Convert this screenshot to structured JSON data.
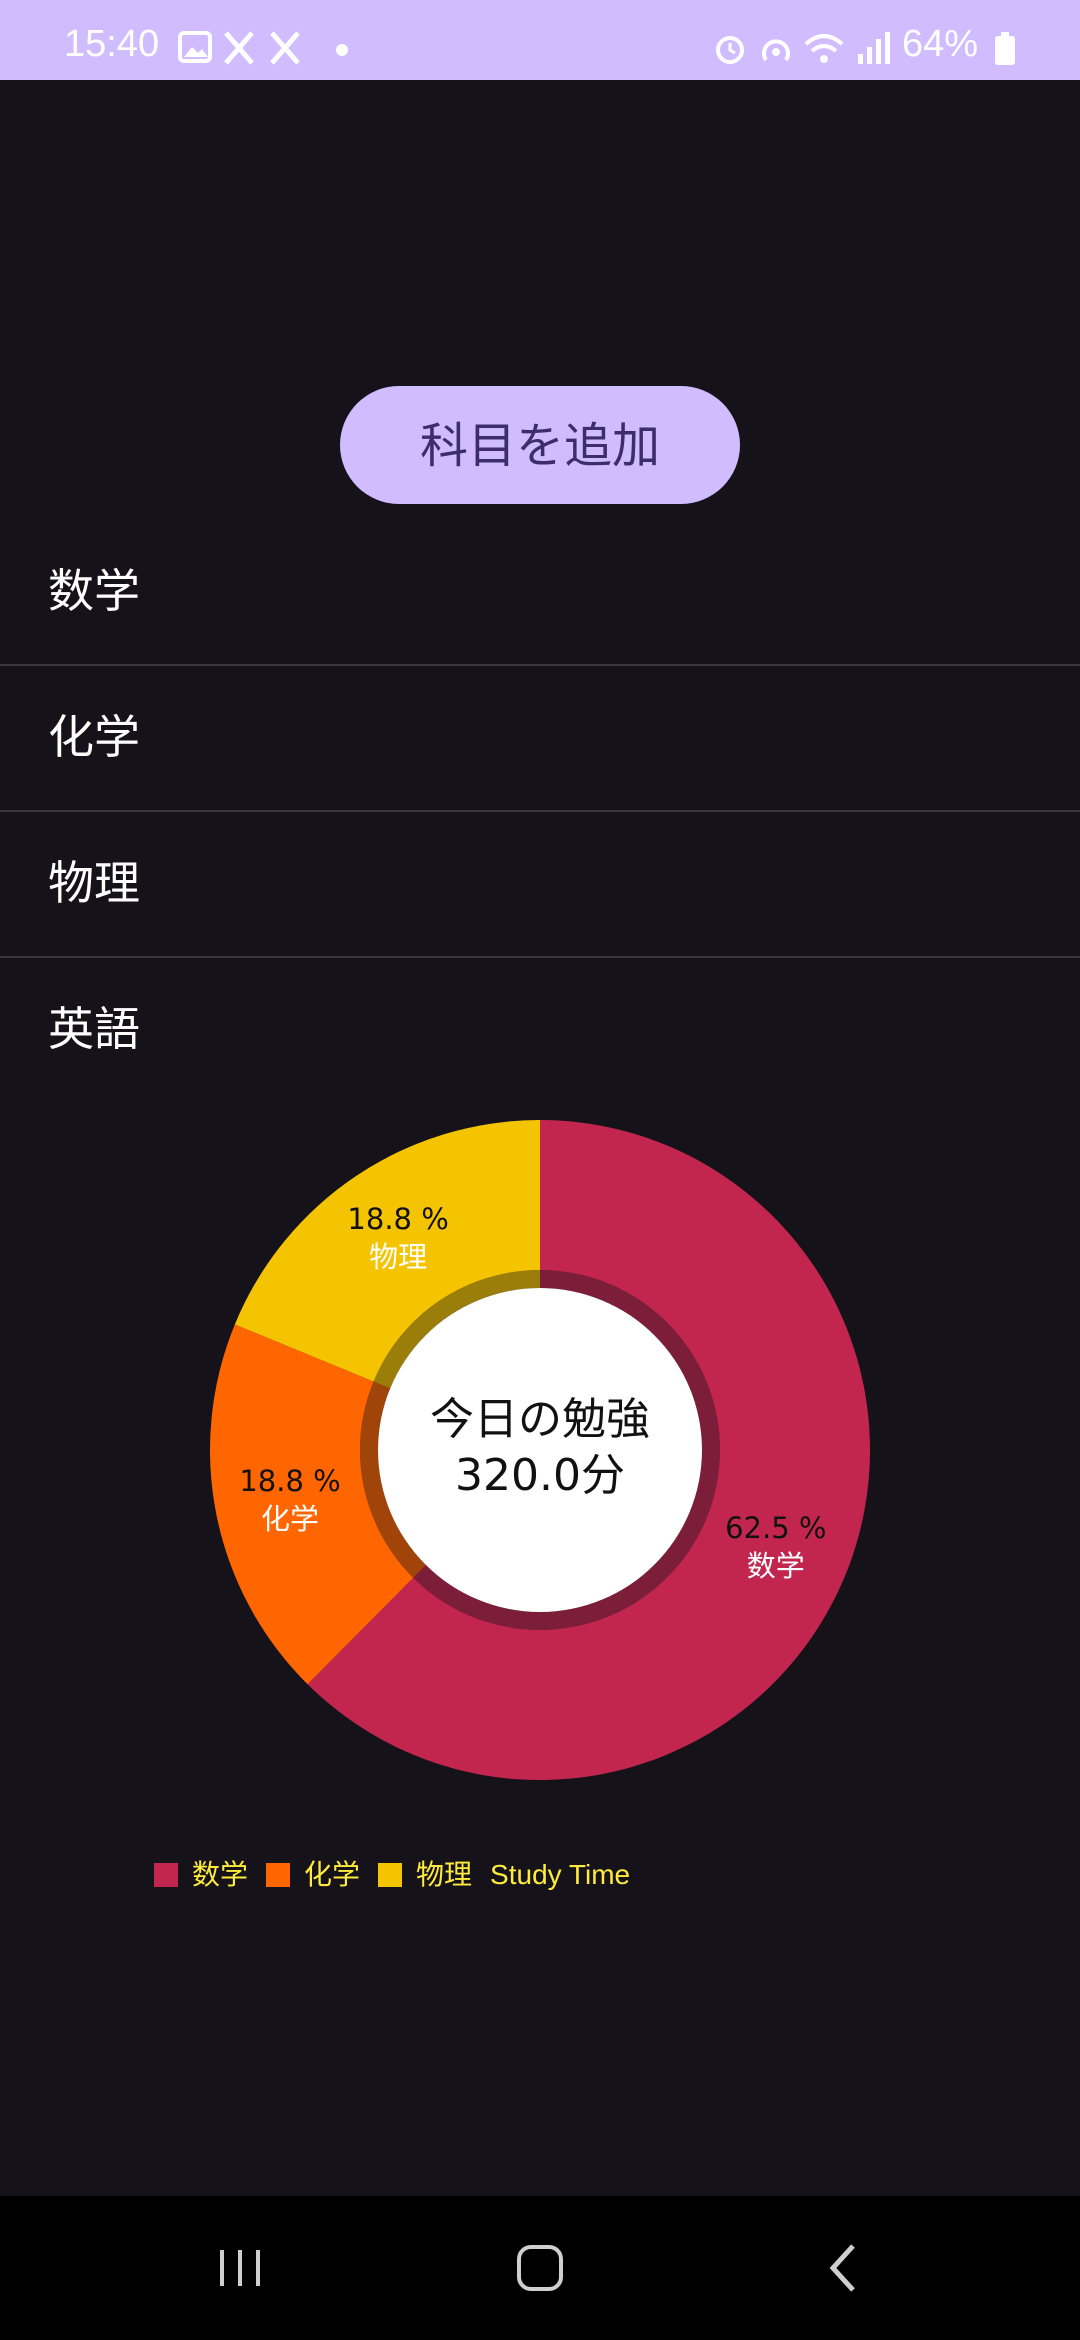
{
  "status_bar": {
    "time": "15:40",
    "battery": "64%",
    "left_icons": [
      "gallery-icon",
      "x-icon",
      "x-icon",
      "dot-icon"
    ],
    "right_icons": [
      "alarm-icon",
      "hotspot-icon",
      "wifi-icon",
      "signal-icon",
      "battery-icon"
    ],
    "background_color": "#d0bcff"
  },
  "add_button": {
    "label": "科目を追加",
    "color": "#d0bcff"
  },
  "subjects": [
    {
      "label": "数学"
    },
    {
      "label": "化学"
    },
    {
      "label": "物理"
    },
    {
      "label": "英語"
    }
  ],
  "center": {
    "line1": "今日の勉強",
    "line2": "320.0分"
  },
  "chart_data": {
    "type": "pie",
    "donut": true,
    "center_text": [
      "今日の勉強",
      "320.0分"
    ],
    "slices": [
      {
        "label": "数学",
        "percent": 62.5,
        "percent_text": "62.5 %",
        "color": "#c2264f"
      },
      {
        "label": "化学",
        "percent": 18.8,
        "percent_text": "18.8 %",
        "color": "#ff6600"
      },
      {
        "label": "物理",
        "percent": 18.8,
        "percent_text": "18.8 %",
        "color": "#f5c400"
      }
    ],
    "legend": {
      "entries": [
        "数学",
        "化学",
        "物理"
      ],
      "dataset_label": "Study Time",
      "placement": "bottom-left"
    }
  },
  "nav_bar": {
    "buttons": [
      "recents-icon",
      "home-icon",
      "back-icon"
    ]
  }
}
